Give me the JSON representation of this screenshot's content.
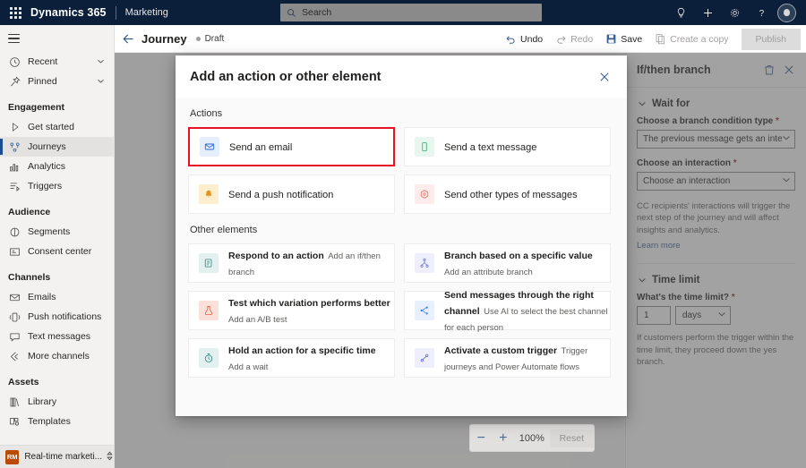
{
  "topbar": {
    "waffle_icon": "app-launcher-icon",
    "brand": "Dynamics 365",
    "app_name": "Marketing",
    "search_placeholder": "Search",
    "icons": [
      "lightbulb-icon",
      "plus-icon",
      "gear-icon",
      "question-icon",
      "avatar"
    ]
  },
  "sidenav": {
    "hamburger": "hamburger-icon",
    "quick": [
      {
        "label": "Recent",
        "icon": "clock-icon",
        "chevron": true
      },
      {
        "label": "Pinned",
        "icon": "pin-icon",
        "chevron": true
      }
    ],
    "groups": [
      {
        "title": "Engagement",
        "items": [
          {
            "label": "Get started",
            "icon": "play-icon",
            "active": false
          },
          {
            "label": "Journeys",
            "icon": "journeys-icon",
            "active": true
          },
          {
            "label": "Analytics",
            "icon": "analytics-icon",
            "active": false
          },
          {
            "label": "Triggers",
            "icon": "triggers-icon",
            "active": false
          }
        ]
      },
      {
        "title": "Audience",
        "items": [
          {
            "label": "Segments",
            "icon": "segments-icon",
            "active": false
          },
          {
            "label": "Consent center",
            "icon": "consent-icon",
            "active": false
          }
        ]
      },
      {
        "title": "Channels",
        "items": [
          {
            "label": "Emails",
            "icon": "email-icon",
            "active": false
          },
          {
            "label": "Push notifications",
            "icon": "push-icon",
            "active": false
          },
          {
            "label": "Text messages",
            "icon": "sms-icon",
            "active": false
          },
          {
            "label": "More channels",
            "icon": "more-channels-icon",
            "active": false
          }
        ]
      },
      {
        "title": "Assets",
        "items": [
          {
            "label": "Library",
            "icon": "library-icon",
            "active": false
          },
          {
            "label": "Templates",
            "icon": "templates-icon",
            "active": false
          }
        ]
      }
    ],
    "area_switcher": {
      "badge": "RM",
      "label": "Real-time marketi...",
      "icon": "up-down-icon"
    }
  },
  "commandbar": {
    "back_icon": "back-arrow-icon",
    "title": "Journey",
    "status": "Draft",
    "buttons": [
      {
        "label": "Undo",
        "icon": "undo-icon",
        "disabled": false
      },
      {
        "label": "Redo",
        "icon": "redo-icon",
        "disabled": true
      },
      {
        "label": "Save",
        "icon": "save-icon",
        "disabled": false
      },
      {
        "label": "Create a copy",
        "icon": "copy-icon",
        "disabled": true
      }
    ],
    "publish_label": "Publish"
  },
  "zoom_control": {
    "minus": "−",
    "plus": "+",
    "level": "100%",
    "reset_label": "Reset"
  },
  "dialog": {
    "title": "Add an action or other element",
    "close_icon": "close-icon",
    "sections": [
      {
        "title": "Actions",
        "cards": [
          {
            "title": "Send an email",
            "subtitle": "",
            "icon": "email-icon",
            "tone": "ic-blue",
            "selected": true
          },
          {
            "title": "Send a text message",
            "subtitle": "",
            "icon": "text-message-icon",
            "tone": "ic-green",
            "selected": false
          },
          {
            "title": "Send a push notification",
            "subtitle": "",
            "icon": "bell-icon",
            "tone": "ic-amber",
            "selected": false
          },
          {
            "title": "Send other types of messages",
            "subtitle": "",
            "icon": "other-messages-icon",
            "tone": "ic-red",
            "selected": false
          }
        ]
      },
      {
        "title": "Other elements",
        "cards": [
          {
            "title": "Respond to an action",
            "subtitle": "Add an if/then branch",
            "icon": "respond-icon",
            "tone": "ic-teal",
            "selected": false
          },
          {
            "title": "Branch based on a specific value",
            "subtitle": "Add an attribute branch",
            "icon": "branch-icon",
            "tone": "ic-violet",
            "selected": false
          },
          {
            "title": "Test which variation performs better",
            "subtitle": "Add an A/B test",
            "icon": "ab-test-icon",
            "tone": "ic-pink",
            "selected": false
          },
          {
            "title": "Send messages through the right channel",
            "subtitle": "Use AI to select the best channel for each person",
            "icon": "channel-optimizer-icon",
            "tone": "ic-lblue",
            "selected": false
          },
          {
            "title": "Hold an action for a specific time",
            "subtitle": "Add a wait",
            "icon": "timer-icon",
            "tone": "ic-teal2",
            "selected": false
          },
          {
            "title": "Activate a custom trigger",
            "subtitle": "Trigger journeys and Power Automate flows",
            "icon": "custom-trigger-icon",
            "tone": "ic-violet2",
            "selected": false
          }
        ]
      }
    ]
  },
  "properties": {
    "title": "If/then branch",
    "delete_icon": "trash-icon",
    "close_icon": "close-icon",
    "sections": {
      "wait_for": {
        "heading": "Wait for",
        "branch_condition_label": "Choose a branch condition type",
        "branch_condition_required": "*",
        "branch_condition_value": "The previous message gets an interacti...",
        "interaction_label": "Choose an interaction",
        "interaction_required": "*",
        "interaction_value": "Choose an interaction",
        "note": "CC recipients' interactions will trigger the next step of the journey and will affect insights and analytics.",
        "link": "Learn more"
      },
      "time_limit": {
        "heading": "Time limit",
        "question_label": "What's the time limit?",
        "question_required": "*",
        "amount": "1",
        "unit": "days",
        "note": "If customers perform the trigger within the time limit, they proceed down the yes branch."
      }
    }
  },
  "colors": {
    "topbar_bg": "#0b1f3a",
    "accent": "#3a5f94",
    "selection_highlight": "#e81123",
    "required": "#a4262c",
    "area_badge": "#b94a00"
  }
}
